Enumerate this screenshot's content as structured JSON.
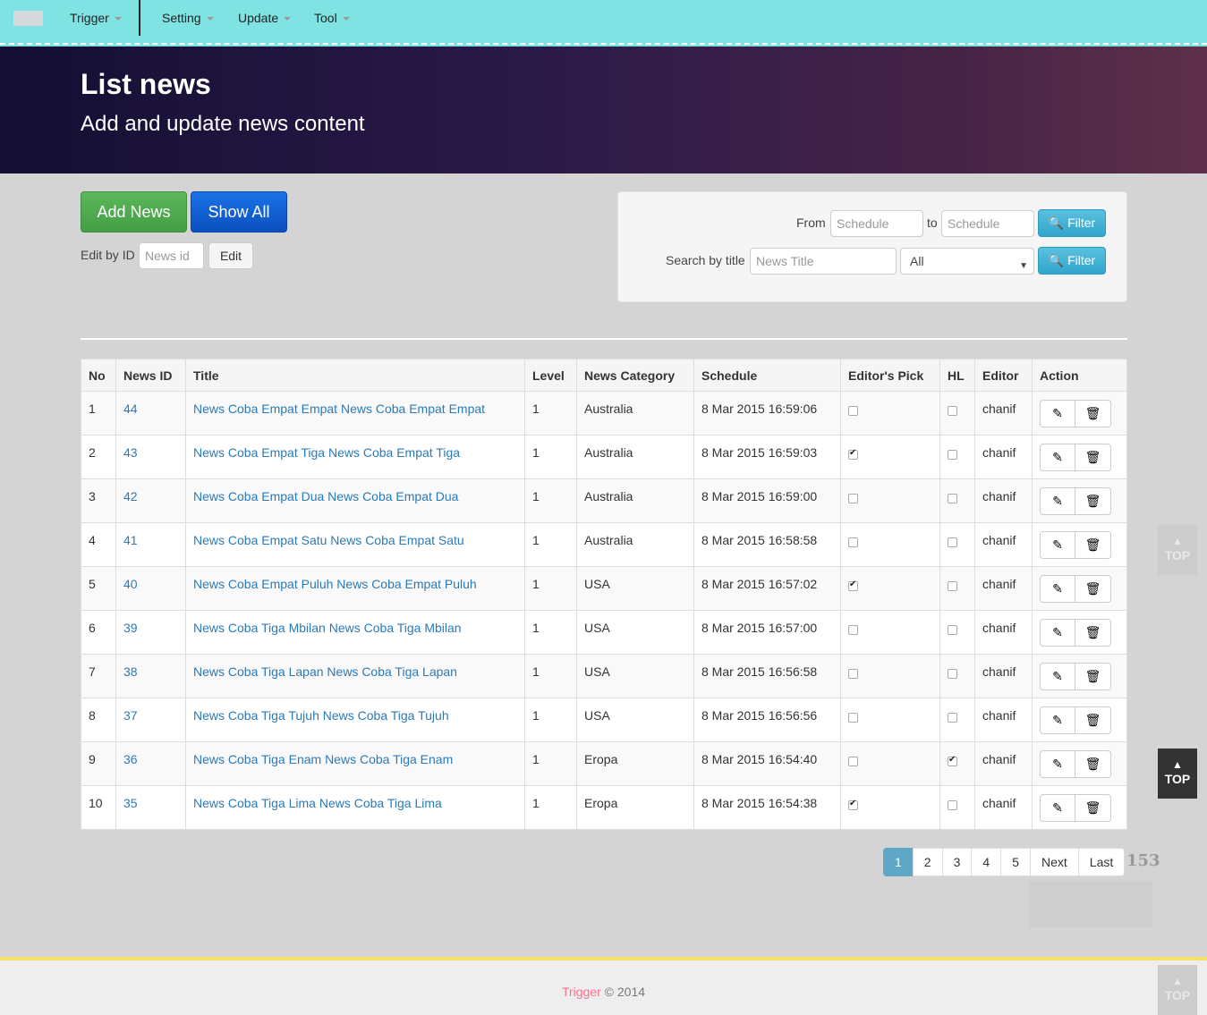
{
  "nav": {
    "items": [
      {
        "label": "Trigger"
      },
      {
        "label": "Setting"
      },
      {
        "label": "Update"
      },
      {
        "label": "Tool"
      }
    ]
  },
  "header": {
    "title": "List news",
    "subtitle": "Add and update news content"
  },
  "actions": {
    "add_label": "Add News",
    "show_all_label": "Show All",
    "edit_by_id_label": "Edit by ID",
    "news_id_placeholder": "News id",
    "edit_label": "Edit"
  },
  "filter": {
    "from_label": "From",
    "from_placeholder": "Schedule",
    "to_label": "to",
    "to_placeholder": "Schedule",
    "filter_label": "Filter",
    "search_label": "Search by title",
    "title_placeholder": "News Title",
    "category_selected": "All",
    "filter2_label": "Filter"
  },
  "table": {
    "headers": [
      "No",
      "News ID",
      "Title",
      "Level",
      "News Category",
      "Schedule",
      "Editor's Pick",
      "HL",
      "Editor",
      "Action"
    ],
    "rows": [
      {
        "no": "1",
        "id": "44",
        "title": "News Coba Empat Empat News Coba Empat Empat",
        "level": "1",
        "category": "Australia",
        "schedule": "8 Mar 2015 16:59:06",
        "pick": false,
        "hl": false,
        "editor": "chanif"
      },
      {
        "no": "2",
        "id": "43",
        "title": "News Coba Empat Tiga News Coba Empat Tiga",
        "level": "1",
        "category": "Australia",
        "schedule": "8 Mar 2015 16:59:03",
        "pick": true,
        "hl": false,
        "editor": "chanif"
      },
      {
        "no": "3",
        "id": "42",
        "title": "News Coba Empat Dua News Coba Empat Dua",
        "level": "1",
        "category": "Australia",
        "schedule": "8 Mar 2015 16:59:00",
        "pick": false,
        "hl": false,
        "editor": "chanif"
      },
      {
        "no": "4",
        "id": "41",
        "title": "News Coba Empat Satu News Coba Empat Satu",
        "level": "1",
        "category": "Australia",
        "schedule": "8 Mar 2015 16:58:58",
        "pick": false,
        "hl": false,
        "editor": "chanif"
      },
      {
        "no": "5",
        "id": "40",
        "title": "News Coba Empat Puluh News Coba Empat Puluh",
        "level": "1",
        "category": "USA",
        "schedule": "8 Mar 2015 16:57:02",
        "pick": true,
        "hl": false,
        "editor": "chanif"
      },
      {
        "no": "6",
        "id": "39",
        "title": "News Coba Tiga Mbilan News Coba Tiga Mbilan",
        "level": "1",
        "category": "USA",
        "schedule": "8 Mar 2015 16:57:00",
        "pick": false,
        "hl": false,
        "editor": "chanif"
      },
      {
        "no": "7",
        "id": "38",
        "title": "News Coba Tiga Lapan News Coba Tiga Lapan",
        "level": "1",
        "category": "USA",
        "schedule": "8 Mar 2015 16:56:58",
        "pick": false,
        "hl": false,
        "editor": "chanif"
      },
      {
        "no": "8",
        "id": "37",
        "title": "News Coba Tiga Tujuh News Coba Tiga Tujuh",
        "level": "1",
        "category": "USA",
        "schedule": "8 Mar 2015 16:56:56",
        "pick": false,
        "hl": false,
        "editor": "chanif"
      },
      {
        "no": "9",
        "id": "36",
        "title": "News Coba Tiga Enam News Coba Tiga Enam",
        "level": "1",
        "category": "Eropa",
        "schedule": "8 Mar 2015 16:54:40",
        "pick": false,
        "hl": true,
        "editor": "chanif"
      },
      {
        "no": "10",
        "id": "35",
        "title": "News Coba Tiga Lima News Coba Tiga Lima",
        "level": "1",
        "category": "Eropa",
        "schedule": "8 Mar 2015 16:54:38",
        "pick": true,
        "hl": false,
        "editor": "chanif"
      }
    ]
  },
  "pagination": {
    "pages": [
      "1",
      "2",
      "3",
      "4",
      "5",
      "Next",
      "Last"
    ],
    "active": "1",
    "total": "153"
  },
  "top_buttons": {
    "label": "TOP"
  },
  "footer": {
    "brand": "Trigger",
    "copyright": "© 2014"
  },
  "colors": {
    "navbar": "#7fe3e3",
    "add_button": "#5cb85c",
    "show_all_button": "#1a73e8",
    "filter_button": "#5bc0de",
    "link": "#2a7ab8",
    "footer_brand": "#ff6f8f",
    "footer_border": "#f6e366"
  }
}
